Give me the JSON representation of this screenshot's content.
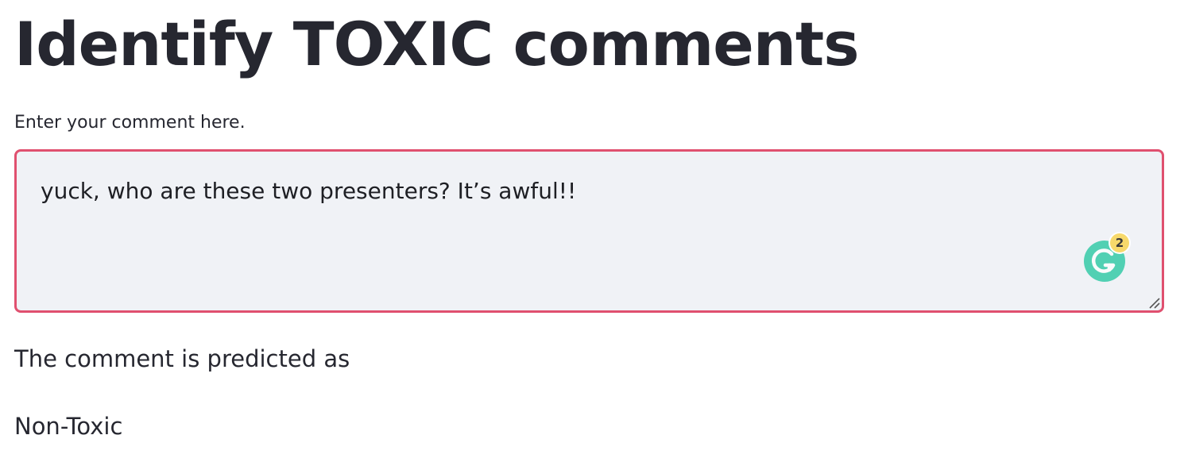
{
  "page": {
    "title": "Identify TOXIC comments"
  },
  "comment_input": {
    "label": "Enter your comment here.",
    "value": "yuck, who are these two presenters? It’s awful!!",
    "border_color": "#e0506f",
    "background_color": "#f0f2f6"
  },
  "grammarly": {
    "icon": "grammarly-icon",
    "badge_count": "2",
    "color": "#15c39a",
    "badge_color": "#f7d96b"
  },
  "result": {
    "prefix": "The comment is predicted as",
    "prediction": "Non-Toxic"
  }
}
